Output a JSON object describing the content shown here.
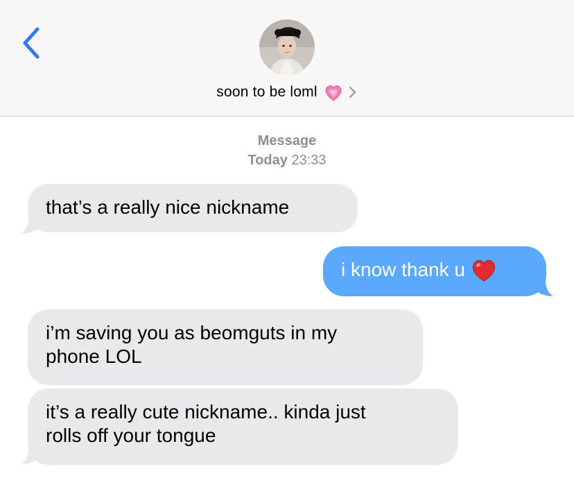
{
  "header": {
    "contact_name": "soon to be loml",
    "contact_emoji": "💗",
    "back_icon": "chevron-left-icon",
    "accent_color": "#3478f6"
  },
  "thread": {
    "service_label": "Message",
    "timestamp_day": "Today",
    "timestamp_time": "23:33"
  },
  "messages": [
    {
      "direction": "incoming",
      "text": "that’s a really nice nickname"
    },
    {
      "direction": "outgoing",
      "text": "i know thank u",
      "emoji": "❤️"
    },
    {
      "direction": "incoming",
      "line1": "i’m saving you as beomguts in my",
      "line2": "phone LOL"
    },
    {
      "direction": "incoming",
      "line1": "it’s a really cute nickname.. kinda just",
      "line2": "rolls off your tongue"
    }
  ],
  "colors": {
    "incoming_bubble": "#e9e9eb",
    "outgoing_bubble": "#5aa9ff",
    "header_bg": "#f7f7f7",
    "meta_text": "#8e8e93"
  }
}
